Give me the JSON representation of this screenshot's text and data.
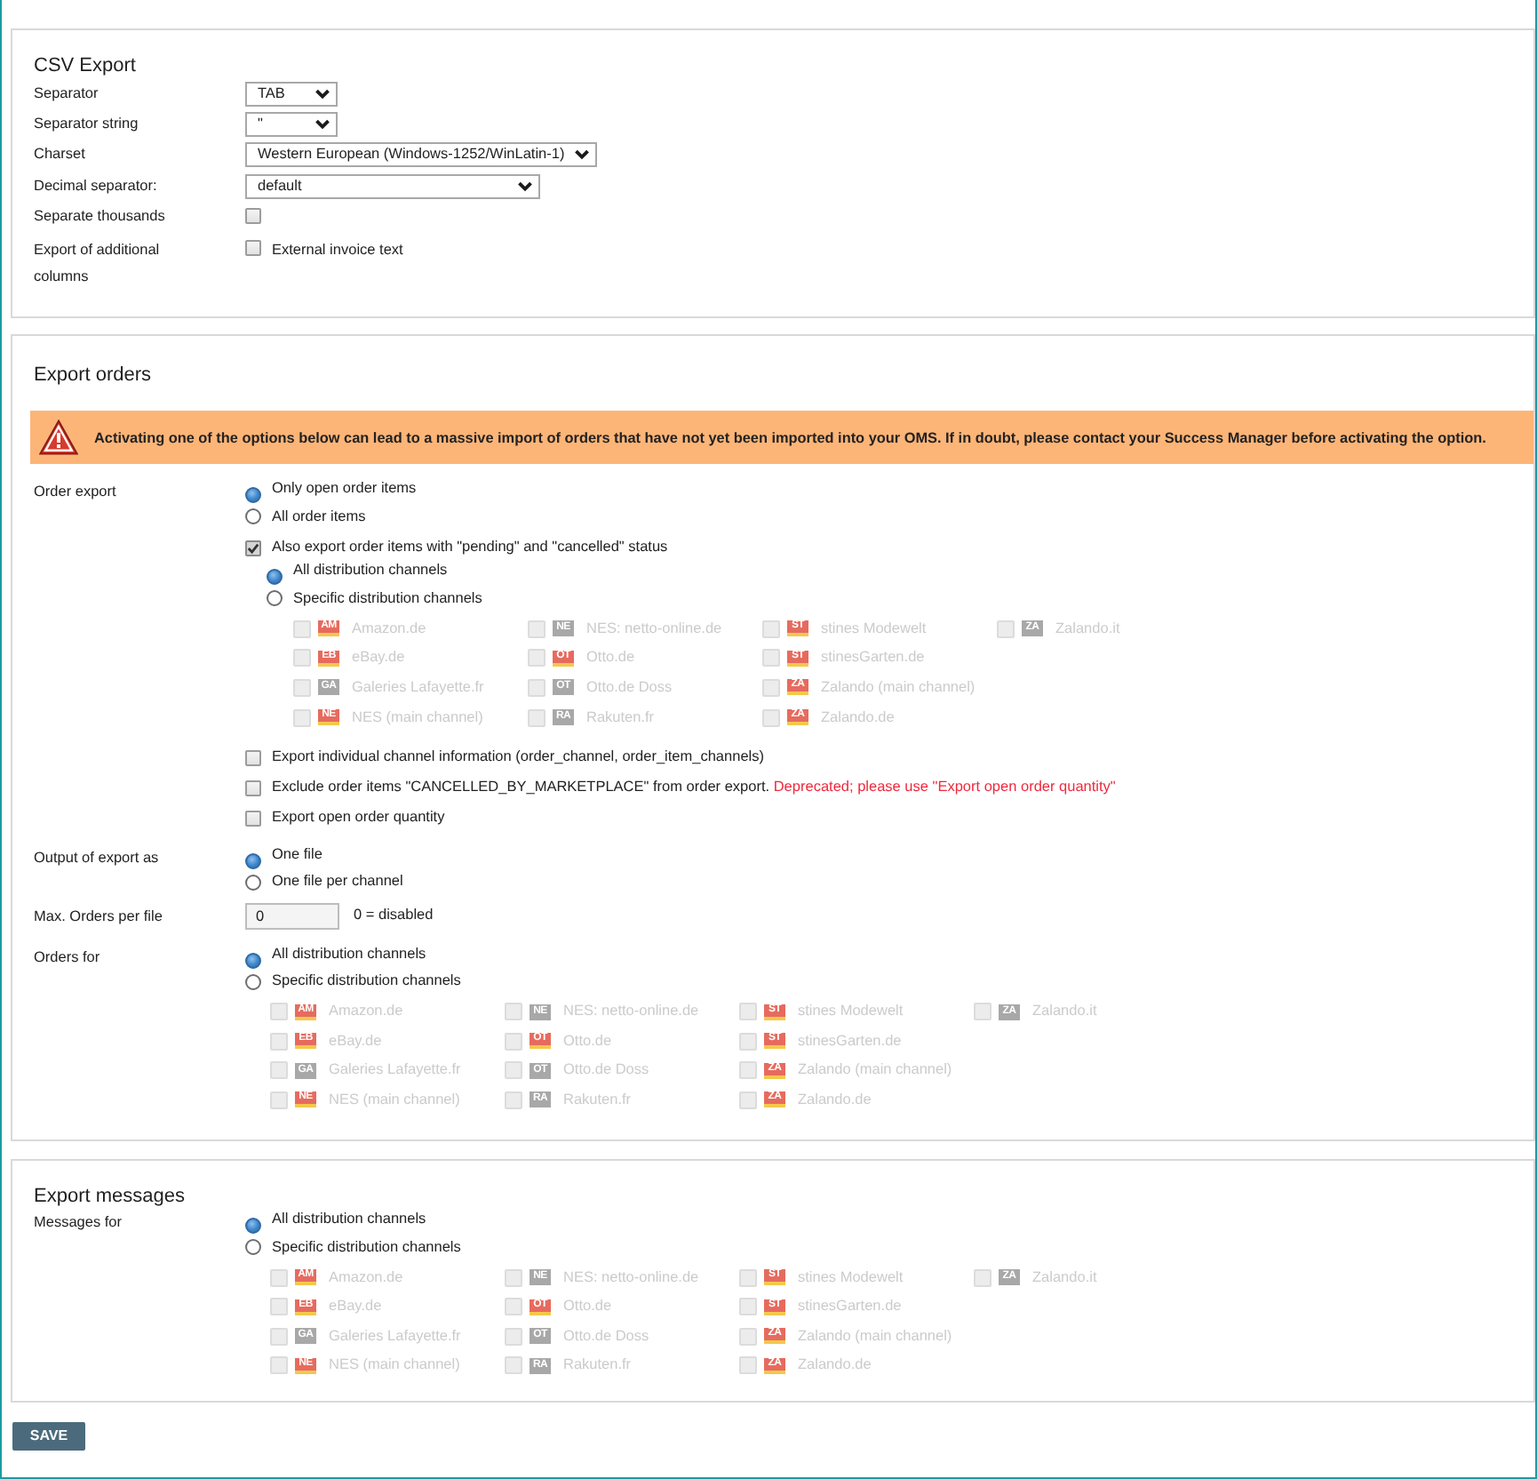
{
  "csv_export": {
    "title": "CSV Export",
    "fields": [
      {
        "kind": "select",
        "label": "Separator",
        "value": "TAB"
      },
      {
        "kind": "select",
        "label": "Separator string",
        "value": "\""
      },
      {
        "kind": "select",
        "label": "Charset",
        "value": "Western European (Windows-1252/WinLatin-1)"
      },
      {
        "kind": "select",
        "label": "Decimal separator:",
        "value": "default"
      },
      {
        "kind": "checkbox",
        "label": "Separate thousands",
        "checked": false
      },
      {
        "kind": "checkbox",
        "label": "Export of additional columns",
        "checked": false,
        "option": "External invoice text"
      }
    ]
  },
  "export_orders": {
    "title": "Export orders",
    "warning": "Activating one of the options below can lead to a massive import of orders that have not yet been imported into your OMS. If in doubt, please contact your Success Manager before activating the option.",
    "order_export": {
      "label": "Order export",
      "options": [
        {
          "label": "Only open order items",
          "selected": true
        },
        {
          "label": "All order items",
          "selected": false
        }
      ],
      "include_pending": {
        "label": "Also export order items with \"pending\" and \"cancelled\" status",
        "checked": true,
        "scope": [
          {
            "label": "All distribution channels",
            "selected": true
          },
          {
            "label": "Specific distribution channels",
            "selected": false
          }
        ],
        "channels": [
          {
            "code": "AM",
            "kind": "flag",
            "name": "Amazon.de",
            "checked": false,
            "disabled": true
          },
          {
            "code": "EB",
            "kind": "flag",
            "name": "eBay.de",
            "checked": false,
            "disabled": true
          },
          {
            "code": "GA",
            "kind": "plain",
            "name": "Galeries Lafayette.fr",
            "checked": false,
            "disabled": true
          },
          {
            "code": "NE",
            "kind": "flag",
            "name": "NES (main channel)",
            "checked": false,
            "disabled": true
          },
          {
            "code": "NE",
            "kind": "plain",
            "name": "NES: netto-online.de",
            "checked": false,
            "disabled": true
          },
          {
            "code": "OT",
            "kind": "flag",
            "name": "Otto.de",
            "checked": false,
            "disabled": true
          },
          {
            "code": "OT",
            "kind": "plain",
            "name": "Otto.de Doss",
            "checked": false,
            "disabled": true
          },
          {
            "code": "RA",
            "kind": "plain",
            "name": "Rakuten.fr",
            "checked": false,
            "disabled": true
          },
          {
            "code": "ST",
            "kind": "flag",
            "name": "stines Modewelt",
            "checked": false,
            "disabled": true
          },
          {
            "code": "ST",
            "kind": "flag",
            "name": "stinesGarten.de",
            "checked": false,
            "disabled": true
          },
          {
            "code": "ZA",
            "kind": "flag",
            "name": "Zalando (main channel)",
            "checked": false,
            "disabled": true
          },
          {
            "code": "ZA",
            "kind": "flag",
            "name": "Zalando.de",
            "checked": false,
            "disabled": true
          },
          {
            "code": "ZA",
            "kind": "plain",
            "name": "Zalando.it",
            "checked": false,
            "disabled": true
          }
        ]
      },
      "checkboxes": [
        {
          "label": "Export individual channel information (order_channel, order_item_channels)",
          "checked": false
        },
        {
          "label": "Exclude order items \"CANCELLED_BY_MARKETPLACE\" from order export.",
          "note": "Deprecated; please use \"Export open order quantity\"",
          "checked": false
        },
        {
          "label": "Export open order quantity",
          "checked": false
        }
      ]
    },
    "output": {
      "label": "Output of export as",
      "options": [
        {
          "label": "One file",
          "selected": true
        },
        {
          "label": "One file per channel",
          "selected": false
        }
      ]
    },
    "max_orders": {
      "label": "Max. Orders per file",
      "value": "0",
      "note": "0 = disabled"
    },
    "orders_for": {
      "label": "Orders for",
      "options": [
        {
          "label": "All distribution channels",
          "selected": true
        },
        {
          "label": "Specific distribution channels",
          "selected": false
        }
      ],
      "channels": [
        {
          "code": "AM",
          "kind": "flag",
          "name": "Amazon.de",
          "checked": false,
          "disabled": true
        },
        {
          "code": "EB",
          "kind": "flag",
          "name": "eBay.de",
          "checked": false,
          "disabled": true
        },
        {
          "code": "GA",
          "kind": "plain",
          "name": "Galeries Lafayette.fr",
          "checked": false,
          "disabled": true
        },
        {
          "code": "NE",
          "kind": "flag",
          "name": "NES (main channel)",
          "checked": false,
          "disabled": true
        },
        {
          "code": "NE",
          "kind": "plain",
          "name": "NES: netto-online.de",
          "checked": false,
          "disabled": true
        },
        {
          "code": "OT",
          "kind": "flag",
          "name": "Otto.de",
          "checked": false,
          "disabled": true
        },
        {
          "code": "OT",
          "kind": "plain",
          "name": "Otto.de Doss",
          "checked": false,
          "disabled": true
        },
        {
          "code": "RA",
          "kind": "plain",
          "name": "Rakuten.fr",
          "checked": false,
          "disabled": true
        },
        {
          "code": "ST",
          "kind": "flag",
          "name": "stines Modewelt",
          "checked": false,
          "disabled": true
        },
        {
          "code": "ST",
          "kind": "flag",
          "name": "stinesGarten.de",
          "checked": false,
          "disabled": true
        },
        {
          "code": "ZA",
          "kind": "flag",
          "name": "Zalando (main channel)",
          "checked": false,
          "disabled": true
        },
        {
          "code": "ZA",
          "kind": "flag",
          "name": "Zalando.de",
          "checked": false,
          "disabled": true
        },
        {
          "code": "ZA",
          "kind": "plain",
          "name": "Zalando.it",
          "checked": false,
          "disabled": true
        }
      ]
    }
  },
  "export_messages": {
    "title": "Export messages",
    "label": "Messages for",
    "options": [
      {
        "label": "All distribution channels",
        "selected": true
      },
      {
        "label": "Specific distribution channels",
        "selected": false
      }
    ],
    "channels": [
      {
        "code": "AM",
        "kind": "flag",
        "name": "Amazon.de",
        "checked": false,
        "disabled": true
      },
      {
        "code": "EB",
        "kind": "flag",
        "name": "eBay.de",
        "checked": false,
        "disabled": true
      },
      {
        "code": "GA",
        "kind": "plain",
        "name": "Galeries Lafayette.fr",
        "checked": false,
        "disabled": true
      },
      {
        "code": "NE",
        "kind": "flag",
        "name": "NES (main channel)",
        "checked": false,
        "disabled": true
      },
      {
        "code": "NE",
        "kind": "plain",
        "name": "NES: netto-online.de",
        "checked": false,
        "disabled": true
      },
      {
        "code": "OT",
        "kind": "flag",
        "name": "Otto.de",
        "checked": false,
        "disabled": true
      },
      {
        "code": "OT",
        "kind": "plain",
        "name": "Otto.de Doss",
        "checked": false,
        "disabled": true
      },
      {
        "code": "RA",
        "kind": "plain",
        "name": "Rakuten.fr",
        "checked": false,
        "disabled": true
      },
      {
        "code": "ST",
        "kind": "flag",
        "name": "stines Modewelt",
        "checked": false,
        "disabled": true
      },
      {
        "code": "ST",
        "kind": "flag",
        "name": "stinesGarten.de",
        "checked": false,
        "disabled": true
      },
      {
        "code": "ZA",
        "kind": "flag",
        "name": "Zalando (main channel)",
        "checked": false,
        "disabled": true
      },
      {
        "code": "ZA",
        "kind": "flag",
        "name": "Zalando.de",
        "checked": false,
        "disabled": true
      },
      {
        "code": "ZA",
        "kind": "plain",
        "name": "Zalando.it",
        "checked": false,
        "disabled": true
      }
    ]
  },
  "save_button": "SAVE"
}
